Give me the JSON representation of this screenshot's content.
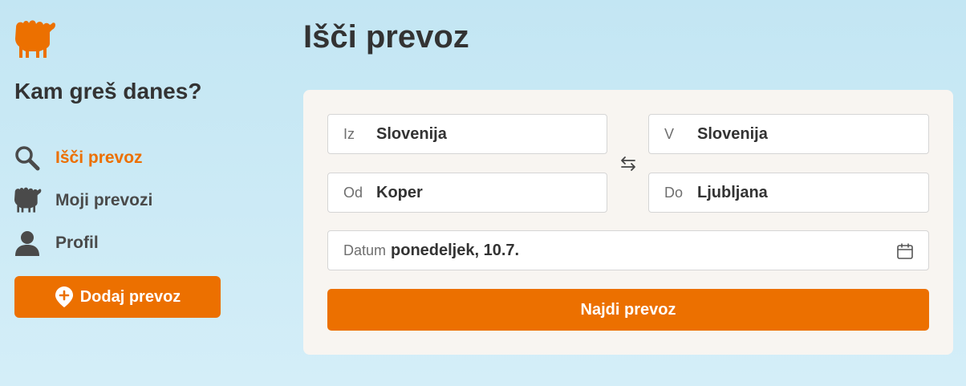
{
  "sidebar": {
    "logo_icon": "camel-logo-icon",
    "tagline": "Kam greš danes?",
    "items": [
      {
        "label": "Išči prevoz",
        "icon": "search-icon",
        "active": true
      },
      {
        "label": "Moji prevozi",
        "icon": "camel-icon",
        "active": false
      },
      {
        "label": "Profil",
        "icon": "user-icon",
        "active": false
      }
    ],
    "add_button": {
      "label": "Dodaj prevoz",
      "icon": "pin-plus-icon"
    }
  },
  "main": {
    "title": "Išči prevoz",
    "form": {
      "from_country": {
        "label": "Iz",
        "value": "Slovenija"
      },
      "to_country": {
        "label": "V",
        "value": "Slovenija"
      },
      "from_city": {
        "label": "Od",
        "value": "Koper"
      },
      "to_city": {
        "label": "Do",
        "value": "Ljubljana"
      },
      "date": {
        "label": "Datum",
        "value": "ponedeljek, 10.7."
      },
      "swap_icon": "swap-arrows-icon",
      "calendar_icon": "calendar-icon",
      "submit_label": "Najdi prevoz"
    }
  },
  "colors": {
    "accent": "#ec7000",
    "background": "#c3e6f3",
    "card": "#f8f5f1",
    "text": "#333333"
  }
}
